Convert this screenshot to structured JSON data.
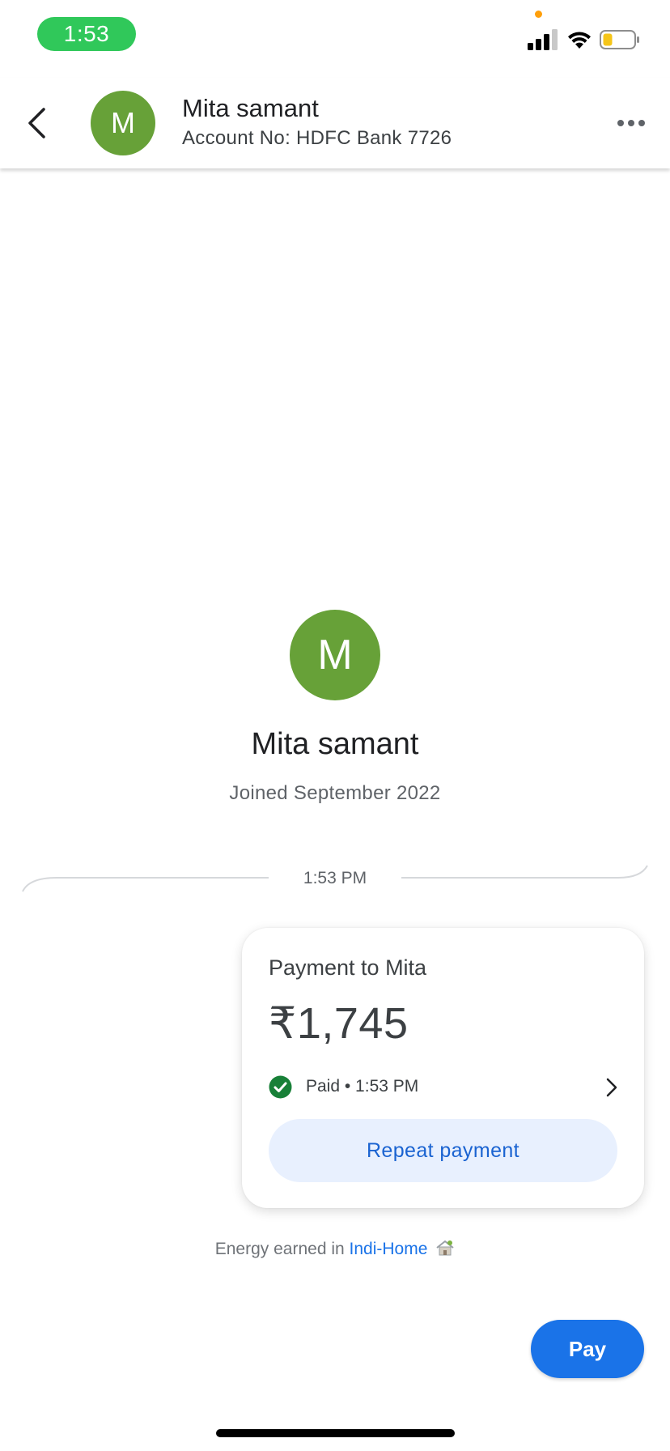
{
  "status_bar": {
    "time": "1:53",
    "battery_color": "#f5c518",
    "pill_color": "#30c85a"
  },
  "header": {
    "avatar_initial": "M",
    "name": "Mita samant",
    "subtitle": "Account No: HDFC Bank 7726",
    "back_icon": "chevron-left-icon",
    "more_icon": "more-horizontal-icon"
  },
  "profile": {
    "avatar_initial": "M",
    "name": "Mita samant",
    "joined": "Joined September 2022",
    "avatar_color": "#67a138"
  },
  "conversation": {
    "divider_time": "1:53 PM"
  },
  "payment_card": {
    "title": "Payment to Mita",
    "amount": "₹1,745",
    "status": "Paid • 1:53 PM",
    "repeat_label": "Repeat payment"
  },
  "energy": {
    "prefix": "Energy earned in ",
    "link": "Indi-Home"
  },
  "pay_button": {
    "label": "Pay"
  },
  "colors": {
    "accent": "#1a73e8",
    "paid_green": "#188038",
    "repeat_bg": "#e8f0fe"
  }
}
